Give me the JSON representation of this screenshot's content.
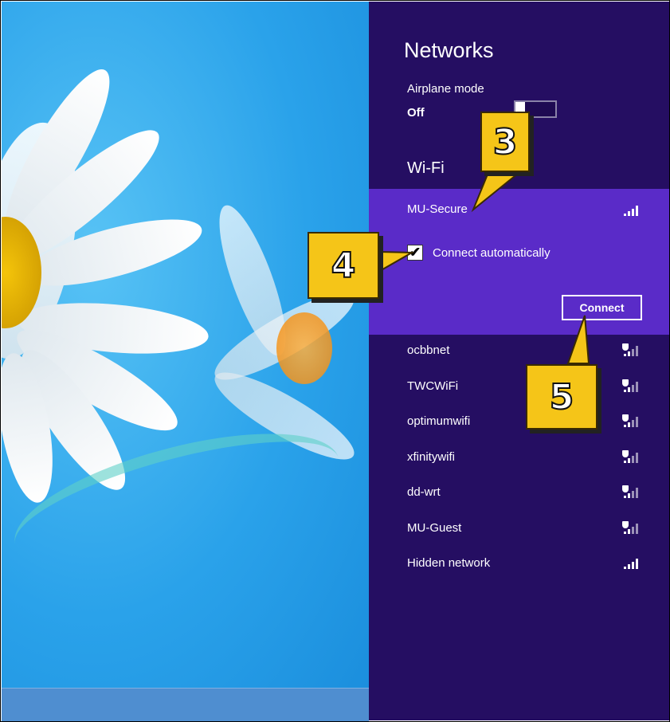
{
  "panel": {
    "title": "Networks",
    "airplane": {
      "label": "Airplane mode",
      "state": "Off"
    },
    "wifi_heading": "Wi-Fi",
    "selected_network": {
      "name": "MU-Secure",
      "connect_auto_label": "Connect automatically",
      "connect_auto_checked": true,
      "connect_button": "Connect"
    },
    "networks": [
      {
        "name": "ocbbnet",
        "secured": true
      },
      {
        "name": "TWCWiFi",
        "secured": true
      },
      {
        "name": "optimumwifi",
        "secured": true
      },
      {
        "name": "xfinitywifi",
        "secured": true
      },
      {
        "name": "dd-wrt",
        "secured": true
      },
      {
        "name": "MU-Guest",
        "secured": true
      },
      {
        "name": "Hidden network",
        "secured": false
      }
    ]
  },
  "callouts": [
    "3",
    "4",
    "5"
  ],
  "colors": {
    "panel_bg": "#250e62",
    "selected_bg": "#5a2bc8",
    "callout": "#f5c518"
  }
}
